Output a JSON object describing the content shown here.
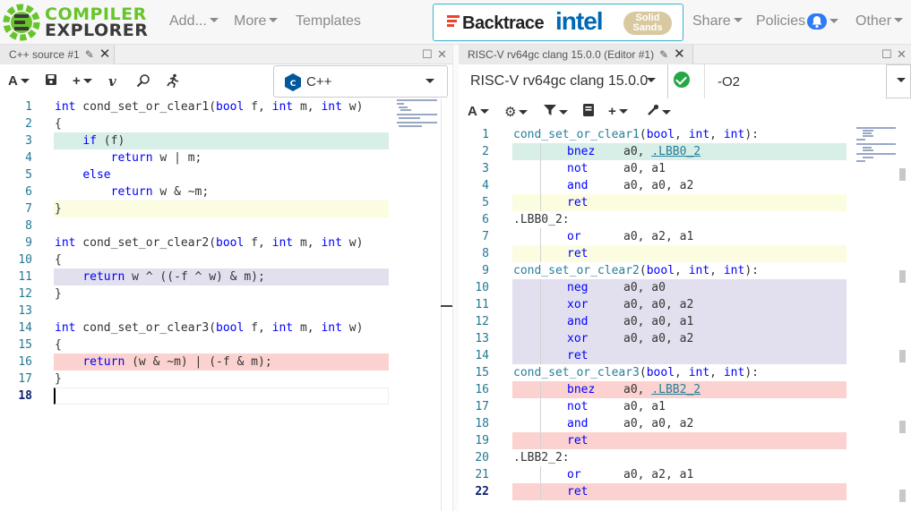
{
  "nav": {
    "logo_line1": "COMPILER",
    "logo_line2": "EXPLORER",
    "add": "Add...",
    "more": "More",
    "templates": "Templates",
    "share": "Share",
    "policies": "Policies",
    "other": "Other",
    "sponsor_backtrace": "Backtrace",
    "sponsor_intel": "intel",
    "sponsor_solid": "Solid Sands"
  },
  "source_pane": {
    "tab_title": "C++ source #1",
    "language": "C++",
    "toolbar": {
      "font_label": "A"
    },
    "lines": [
      {
        "n": "1",
        "text": "int cond_set_or_clear1(bool f, int m, int w)",
        "hl": ""
      },
      {
        "n": "2",
        "text": "{",
        "hl": ""
      },
      {
        "n": "3",
        "text": "    if (f)",
        "hl": "green"
      },
      {
        "n": "4",
        "text": "        return w | m;",
        "hl": ""
      },
      {
        "n": "5",
        "text": "    else",
        "hl": ""
      },
      {
        "n": "6",
        "text": "        return w & ~m;",
        "hl": ""
      },
      {
        "n": "7",
        "text": "}",
        "hl": "yellow"
      },
      {
        "n": "8",
        "text": "",
        "hl": ""
      },
      {
        "n": "9",
        "text": "int cond_set_or_clear2(bool f, int m, int w)",
        "hl": ""
      },
      {
        "n": "10",
        "text": "{",
        "hl": ""
      },
      {
        "n": "11",
        "text": "    return w ^ ((-f ^ w) & m);",
        "hl": "purple"
      },
      {
        "n": "12",
        "text": "}",
        "hl": ""
      },
      {
        "n": "13",
        "text": "",
        "hl": ""
      },
      {
        "n": "14",
        "text": "int cond_set_or_clear3(bool f, int m, int w)",
        "hl": ""
      },
      {
        "n": "15",
        "text": "{",
        "hl": ""
      },
      {
        "n": "16",
        "text": "    return (w & ~m) | (-f & m);",
        "hl": "red"
      },
      {
        "n": "17",
        "text": "}",
        "hl": ""
      },
      {
        "n": "18",
        "text": "",
        "hl": "cursor"
      }
    ]
  },
  "asm_pane": {
    "tab_title": "RISC-V rv64gc clang 15.0.0 (Editor #1)",
    "compiler": "RISC-V rv64gc clang 15.0.0",
    "options": "-O2",
    "toolbar": {
      "font_label": "A"
    },
    "lines": [
      {
        "n": "1",
        "label": "cond_set_or_clear1(bool, int, int):",
        "op": "",
        "args": "",
        "link": "",
        "hl": ""
      },
      {
        "n": "2",
        "label": "",
        "op": "bnez",
        "args": "a0, ",
        "link": ".LBB0_2",
        "hl": "green"
      },
      {
        "n": "3",
        "label": "",
        "op": "not",
        "args": "a0, a1",
        "link": "",
        "hl": ""
      },
      {
        "n": "4",
        "label": "",
        "op": "and",
        "args": "a0, a0, a2",
        "link": "",
        "hl": ""
      },
      {
        "n": "5",
        "label": "",
        "op": "ret",
        "args": "",
        "link": "",
        "hl": "yellow"
      },
      {
        "n": "6",
        "label": ".LBB0_2:",
        "op": "",
        "args": "",
        "link": "",
        "hl": ""
      },
      {
        "n": "7",
        "label": "",
        "op": "or",
        "args": "a0, a2, a1",
        "link": "",
        "hl": ""
      },
      {
        "n": "8",
        "label": "",
        "op": "ret",
        "args": "",
        "link": "",
        "hl": "yellow"
      },
      {
        "n": "9",
        "label": "cond_set_or_clear2(bool, int, int):",
        "op": "",
        "args": "",
        "link": "",
        "hl": ""
      },
      {
        "n": "10",
        "label": "",
        "op": "neg",
        "args": "a0, a0",
        "link": "",
        "hl": "purple"
      },
      {
        "n": "11",
        "label": "",
        "op": "xor",
        "args": "a0, a0, a2",
        "link": "",
        "hl": "purple"
      },
      {
        "n": "12",
        "label": "",
        "op": "and",
        "args": "a0, a0, a1",
        "link": "",
        "hl": "purple"
      },
      {
        "n": "13",
        "label": "",
        "op": "xor",
        "args": "a0, a0, a2",
        "link": "",
        "hl": "purple"
      },
      {
        "n": "14",
        "label": "",
        "op": "ret",
        "args": "",
        "link": "",
        "hl": "purple"
      },
      {
        "n": "15",
        "label": "cond_set_or_clear3(bool, int, int):",
        "op": "",
        "args": "",
        "link": "",
        "hl": ""
      },
      {
        "n": "16",
        "label": "",
        "op": "bnez",
        "args": "a0, ",
        "link": ".LBB2_2",
        "hl": "red"
      },
      {
        "n": "17",
        "label": "",
        "op": "not",
        "args": "a0, a1",
        "link": "",
        "hl": ""
      },
      {
        "n": "18",
        "label": "",
        "op": "and",
        "args": "a0, a0, a2",
        "link": "",
        "hl": ""
      },
      {
        "n": "19",
        "label": "",
        "op": "ret",
        "args": "",
        "link": "",
        "hl": "red"
      },
      {
        "n": "20",
        "label": ".LBB2_2:",
        "op": "",
        "args": "",
        "link": "",
        "hl": ""
      },
      {
        "n": "21",
        "label": "",
        "op": "or",
        "args": "a0, a2, a1",
        "link": "",
        "hl": ""
      },
      {
        "n": "22",
        "label": "",
        "op": "ret",
        "args": "",
        "link": "",
        "hl": "red"
      }
    ]
  },
  "colors": {
    "green": "#d7efe6",
    "yellow": "#fcfce1",
    "purple": "#e2e0ee",
    "red": "#fbd2cf",
    "brand_green": "#67c52a",
    "accent_blue": "#36b3c9"
  }
}
